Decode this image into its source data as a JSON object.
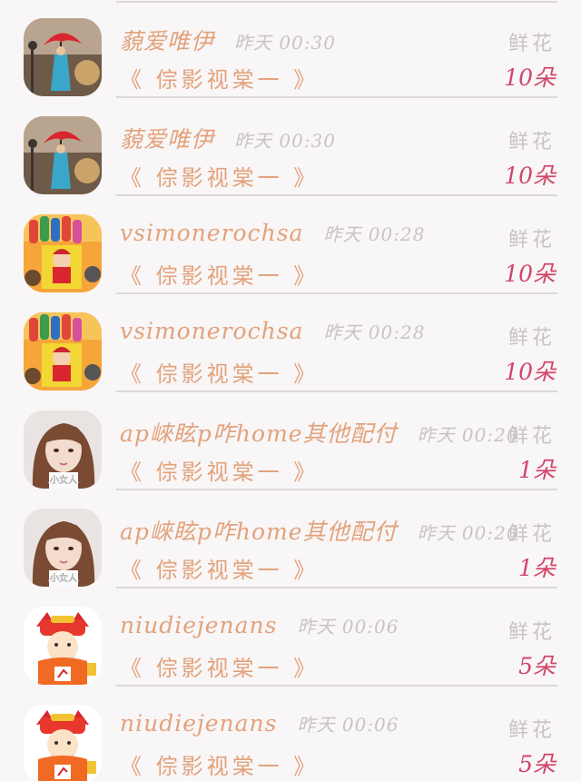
{
  "colors": {
    "accent_orange": "#e3a27c",
    "count_red": "#d2456a",
    "muted_gray": "#c9c4c4",
    "divider": "#dcd8d8",
    "background": "#f8f6f6"
  },
  "gifts": [
    {
      "user": "藐爱唯伊",
      "time": "昨天 00:30",
      "gift_label": "鲜花",
      "gift_name": "《 倧影视棠一 》",
      "count": "10朵",
      "avatar_icon": "girl-red-umbrella-painting"
    },
    {
      "user": "藐爱唯伊",
      "time": "昨天 00:30",
      "gift_label": "鲜花",
      "gift_name": "《 倧影视棠一 》",
      "count": "10朵",
      "avatar_icon": "girl-red-umbrella-painting"
    },
    {
      "user": "vsimonerochsa",
      "time": "昨天 00:28",
      "gift_label": "鲜花",
      "gift_name": "《 倧影视棠一 》",
      "count": "10朵",
      "avatar_icon": "cartoon-fortune-god-figures"
    },
    {
      "user": "vsimonerochsa",
      "time": "昨天 00:28",
      "gift_label": "鲜花",
      "gift_name": "《 倧影视棠一 》",
      "count": "10朵",
      "avatar_icon": "cartoon-fortune-god-figures"
    },
    {
      "user": "ap崍眩p咋home其他配付",
      "time": "昨天 00:20",
      "gift_label": "鲜花",
      "gift_name": "《 倧影视棠一 》",
      "count": "1朵",
      "avatar_icon": "girl-portrait-photo",
      "avatar_caption": ".小女人."
    },
    {
      "user": "ap崍眩p咋home其他配付",
      "time": "昨天 00:20",
      "gift_label": "鲜花",
      "gift_name": "《 倧影视棠一 》",
      "count": "1朵",
      "avatar_icon": "girl-portrait-photo",
      "avatar_caption": ".小女人."
    },
    {
      "user": "niudiejenans",
      "time": "昨天 00:06",
      "gift_label": "鲜花",
      "gift_name": "《 倧影视棠一 》",
      "count": "5朵",
      "avatar_icon": "cartoon-god-of-wealth"
    },
    {
      "user": "niudiejenans",
      "time": "昨天 00:06",
      "gift_label": "鲜花",
      "gift_name": "《 倧影视棠一 》",
      "count": "5朵",
      "avatar_icon": "cartoon-god-of-wealth"
    }
  ]
}
